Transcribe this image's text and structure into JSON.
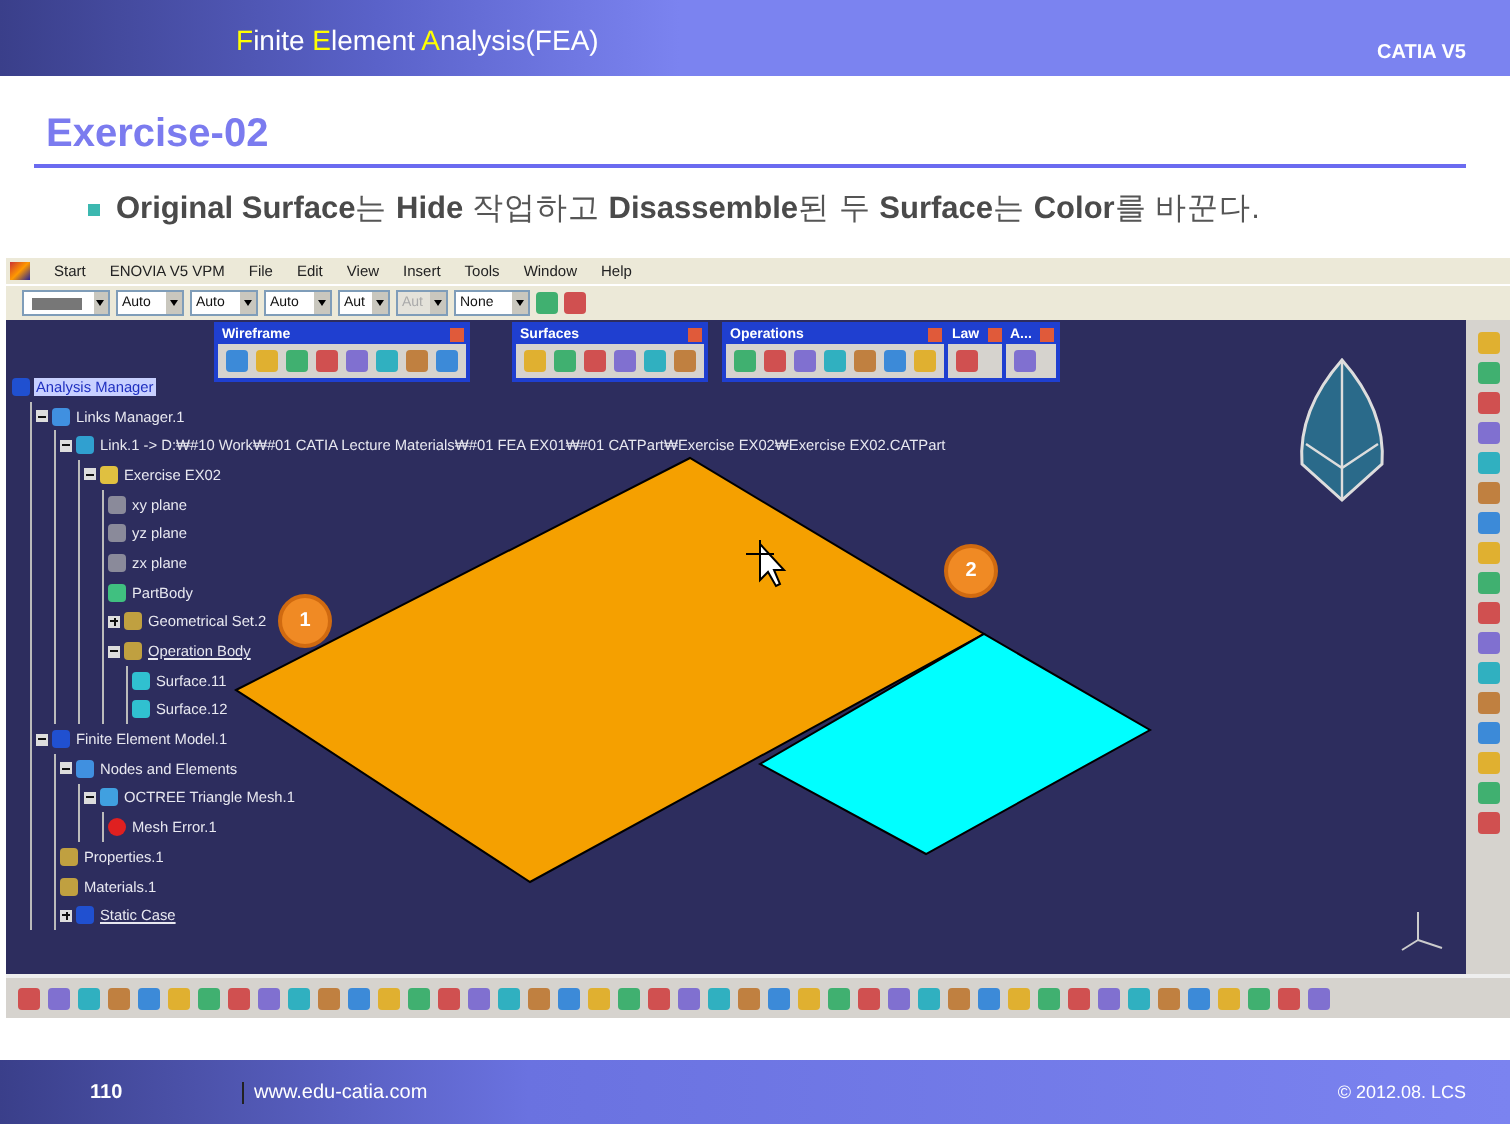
{
  "header": {
    "title_parts": [
      {
        "text": "F",
        "accent": true
      },
      {
        "text": "inite ",
        "accent": false
      },
      {
        "text": "E",
        "accent": true
      },
      {
        "text": "lement ",
        "accent": false
      },
      {
        "text": "A",
        "accent": true
      },
      {
        "text": "nalysis(FEA)",
        "accent": false
      }
    ],
    "product": "CATIA V5"
  },
  "slide_title": "Exercise-02",
  "bullet": "**Original Surface**는 **Hide** 작업하고 **Disassemble**된 두 **Surface**는 **Color**를 바꾼다.",
  "catia": {
    "menu": [
      "Start",
      "ENOVIA V5 VPM",
      "File",
      "Edit",
      "View",
      "Insert",
      "Tools",
      "Window",
      "Help"
    ],
    "property_toolbar": [
      {
        "value": "Auto",
        "disabled": false
      },
      {
        "value": "Auto",
        "disabled": false
      },
      {
        "value": "Auto",
        "disabled": false
      },
      {
        "value": "Aut",
        "disabled": false
      },
      {
        "value": "Aut",
        "disabled": true
      },
      {
        "value": "None",
        "disabled": false
      }
    ],
    "toolbars": [
      {
        "title": "Wireframe"
      },
      {
        "title": "Surfaces"
      },
      {
        "title": "Operations"
      },
      {
        "title": "Law"
      },
      {
        "title": "A..."
      }
    ],
    "tree": [
      {
        "label": "Analysis Manager",
        "kind": "manager",
        "selected": true,
        "underlined": false,
        "children": [
          {
            "label": "Links Manager.1",
            "kind": "links",
            "selected": false,
            "underlined": false,
            "expanded": true,
            "children": [
              {
                "label": "Link.1 -> D:₩#10 Work₩#01 CATIA Lecture Materials₩#01 FEA EX01₩#01 CATPart₩Exercise EX02₩Exercise EX02.CATPart",
                "kind": "link",
                "selected": false,
                "underlined": false,
                "expanded": true,
                "children": [
                  {
                    "label": "Exercise EX02",
                    "kind": "part",
                    "selected": false,
                    "underlined": false,
                    "expanded": true,
                    "children": [
                      {
                        "label": "xy plane",
                        "kind": "plane",
                        "selected": false,
                        "underlined": false
                      },
                      {
                        "label": "yz plane",
                        "kind": "plane",
                        "selected": false,
                        "underlined": false
                      },
                      {
                        "label": "zx plane",
                        "kind": "plane",
                        "selected": false,
                        "underlined": false
                      },
                      {
                        "label": "PartBody",
                        "kind": "body",
                        "selected": false,
                        "underlined": false
                      },
                      {
                        "label": "Geometrical Set.2",
                        "kind": "set",
                        "selected": false,
                        "underlined": false,
                        "expanded": false
                      },
                      {
                        "label": "Operation Body",
                        "kind": "set",
                        "selected": false,
                        "underlined": true,
                        "expanded": true,
                        "children": [
                          {
                            "label": "Surface.11",
                            "kind": "surface",
                            "selected": false,
                            "underlined": false
                          },
                          {
                            "label": "Surface.12",
                            "kind": "surface",
                            "selected": false,
                            "underlined": false
                          }
                        ]
                      }
                    ]
                  }
                ]
              }
            ]
          },
          {
            "label": "Finite Element Model.1",
            "kind": "manager",
            "selected": false,
            "underlined": false,
            "expanded": true,
            "children": [
              {
                "label": "Nodes and Elements",
                "kind": "links",
                "selected": false,
                "underlined": false,
                "expanded": true,
                "children": [
                  {
                    "label": "OCTREE Triangle Mesh.1",
                    "kind": "mesh",
                    "selected": false,
                    "underlined": false,
                    "expanded": true,
                    "children": [
                      {
                        "label": "Mesh Error.1",
                        "kind": "error",
                        "selected": false,
                        "underlined": false
                      }
                    ]
                  }
                ]
              },
              {
                "label": "Properties.1",
                "kind": "set",
                "selected": false,
                "underlined": false
              },
              {
                "label": "Materials.1",
                "kind": "set",
                "selected": false,
                "underlined": false
              },
              {
                "label": "Static Case",
                "kind": "manager",
                "selected": false,
                "underlined": true,
                "expanded": false
              }
            ]
          }
        ]
      }
    ],
    "callouts": [
      {
        "number": "1"
      },
      {
        "number": "2"
      }
    ]
  },
  "footer": {
    "page": "110",
    "url": "www.edu-catia.com",
    "copyright": "© 2012.08. LCS"
  }
}
